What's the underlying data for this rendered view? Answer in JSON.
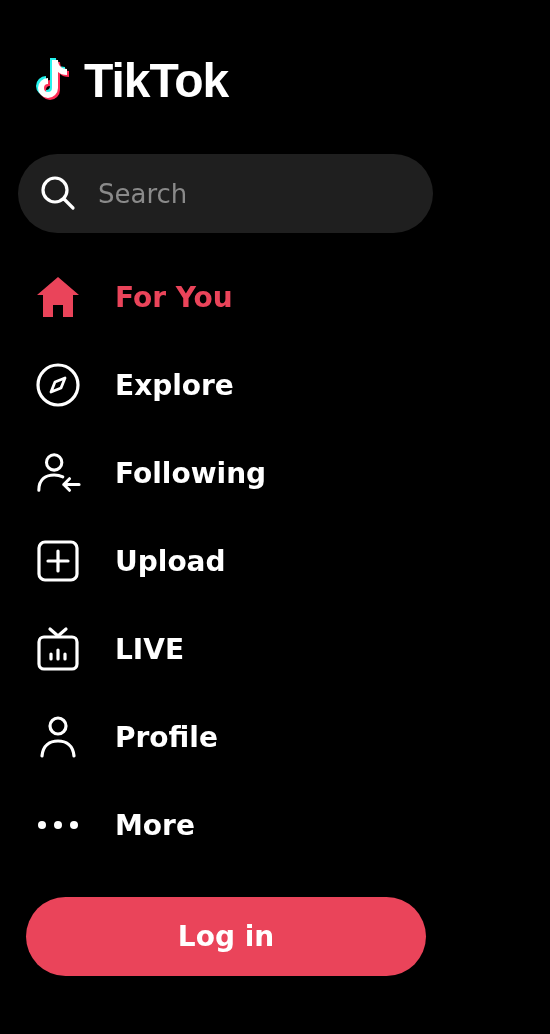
{
  "brand": {
    "name": "TikTok"
  },
  "search": {
    "placeholder": "Search"
  },
  "nav": [
    {
      "label": "For You",
      "selected": true
    },
    {
      "label": "Explore",
      "selected": false
    },
    {
      "label": "Following",
      "selected": false
    },
    {
      "label": "Upload",
      "selected": false
    },
    {
      "label": "LIVE",
      "selected": false
    },
    {
      "label": "Profile",
      "selected": false
    },
    {
      "label": "More",
      "selected": false
    }
  ],
  "login_button": "Log in"
}
